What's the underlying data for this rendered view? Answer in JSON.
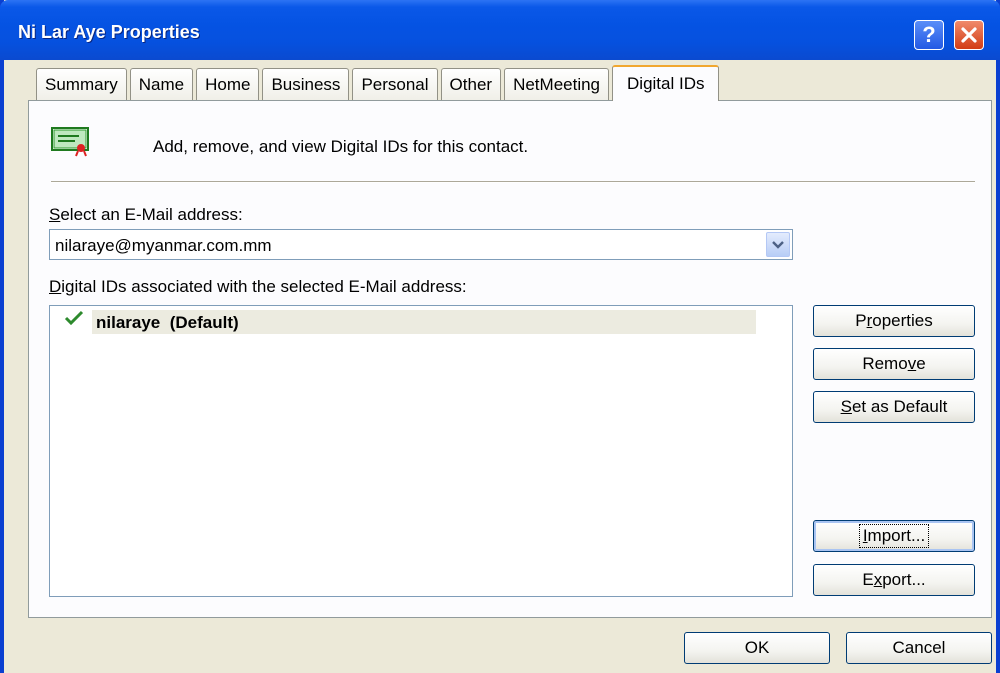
{
  "window": {
    "title": "Ni Lar Aye Properties"
  },
  "tabs": [
    {
      "label": "Summary"
    },
    {
      "label": "Name"
    },
    {
      "label": "Home"
    },
    {
      "label": "Business"
    },
    {
      "label": "Personal"
    },
    {
      "label": "Other"
    },
    {
      "label": "NetMeeting"
    },
    {
      "label": "Digital IDs"
    }
  ],
  "active_tab": "Digital IDs",
  "header": {
    "description": "Add, remove, and view Digital IDs for this contact."
  },
  "email_select": {
    "label_prefix": "S",
    "label_rest": "elect an E-Mail address:",
    "value": "nilaraye@myanmar.com.mm"
  },
  "digital_ids": {
    "label_prefix": "D",
    "label_rest": "igital IDs associated with the selected E-Mail address:",
    "items": [
      {
        "name": "nilaraye  (Default)"
      }
    ]
  },
  "buttons": {
    "properties": {
      "a": "P",
      "u": "r",
      "b": "operties"
    },
    "remove": {
      "a": "Remo",
      "u": "v",
      "b": "e"
    },
    "set_default": {
      "a": "",
      "u": "S",
      "b": "et as Default"
    },
    "import": {
      "a": "",
      "u": "I",
      "b": "mport..."
    },
    "export": {
      "a": "E",
      "u": "x",
      "b": "port..."
    },
    "ok": "OK",
    "cancel": "Cancel"
  },
  "colors": {
    "titlebar": "#0553e3",
    "face": "#ece9d8",
    "check": "#2d8a2d"
  }
}
